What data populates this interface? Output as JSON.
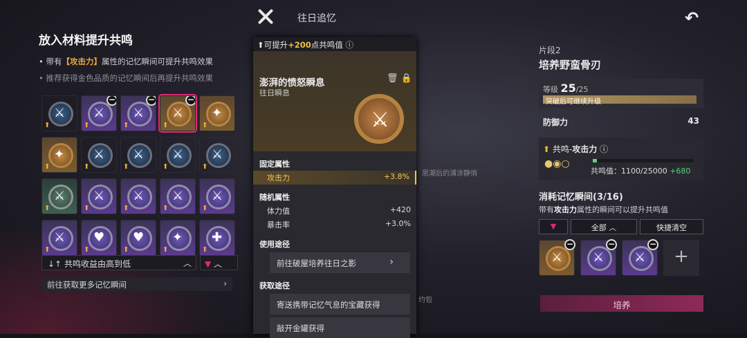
{
  "header": {
    "title": "往日追忆"
  },
  "left": {
    "title": "放入材料提升共鸣",
    "note1_pre": "带有",
    "note1_key": "【攻击力】",
    "note1_post": "属性的记忆瞬间可提升共鸣效果",
    "note2": "推荐获得金色品质的记忆瞬间后再提升共鸣效果",
    "sort_label": "共鸣收益由高到低",
    "more_label": "前往获取更多记忆瞬间"
  },
  "grid": [
    {
      "color": "blue",
      "glyph": "⚔",
      "minus": false,
      "selected": false
    },
    {
      "color": "purple",
      "glyph": "⚔",
      "minus": true,
      "selected": false
    },
    {
      "color": "purple",
      "glyph": "⚔",
      "minus": true,
      "selected": false
    },
    {
      "color": "gold",
      "glyph": "⚔",
      "minus": true,
      "selected": true
    },
    {
      "color": "gold",
      "glyph": "✦",
      "minus": false,
      "selected": false
    },
    {
      "color": "gold",
      "glyph": "✦",
      "minus": false,
      "selected": false
    },
    {
      "color": "blue",
      "glyph": "⚔",
      "minus": false,
      "selected": false
    },
    {
      "color": "blue",
      "glyph": "⚔",
      "minus": false,
      "selected": false
    },
    {
      "color": "blue",
      "glyph": "⚔",
      "minus": false,
      "selected": false
    },
    {
      "color": "blue",
      "glyph": "⚔",
      "minus": false,
      "selected": false
    },
    {
      "color": "green",
      "glyph": "⚔",
      "minus": false,
      "selected": false
    },
    {
      "color": "purple",
      "glyph": "⚔",
      "minus": false,
      "selected": false
    },
    {
      "color": "purple",
      "glyph": "⚔",
      "minus": false,
      "selected": false
    },
    {
      "color": "purple",
      "glyph": "⚔",
      "minus": false,
      "selected": false
    },
    {
      "color": "purple",
      "glyph": "⚔",
      "minus": false,
      "selected": false
    },
    {
      "color": "purple",
      "glyph": "⚔",
      "minus": false,
      "selected": false
    },
    {
      "color": "purple",
      "glyph": "♥",
      "minus": false,
      "selected": false
    },
    {
      "color": "purple",
      "glyph": "♥",
      "minus": false,
      "selected": false
    },
    {
      "color": "purple",
      "glyph": "✦",
      "minus": false,
      "selected": false
    },
    {
      "color": "purple",
      "glyph": "✚",
      "minus": false,
      "selected": false
    }
  ],
  "tooltip": {
    "caption_pre": "可提升",
    "caption_value": "+200",
    "caption_post": "点共鸣值",
    "name": "澎湃的愤怒瞬息",
    "subtitle": "往日瞬息",
    "fixed_title": "固定属性",
    "fixed_stat": "攻击力",
    "fixed_value": "+3.8%",
    "random_title": "随机属性",
    "random": [
      {
        "name": "体力值",
        "value": "+420"
      },
      {
        "name": "暴击率",
        "value": "+3.0%"
      }
    ],
    "use_title": "使用途径",
    "use_btn": "前往破屋培养往日之影",
    "get_title": "获取途径",
    "get1": "寄送携带记忆气息的宝藏获得",
    "get2": "敲开金罐获得"
  },
  "right": {
    "fragment": "片段2",
    "name": "培养野蛮骨刃",
    "level_label": "等级",
    "level": "25",
    "level_max": "/25",
    "level_note": "突破后可继续升级",
    "def_label": "防御力",
    "def_value": "43",
    "reso_pre": "共鸣-",
    "reso_key": "攻击力",
    "reso_value_label": "共鸣值：",
    "reso_value": "1100/25000",
    "reso_gain": "+680",
    "reso_fill": 0.044
  },
  "consume": {
    "title": "消耗记忆瞬间(3/16)",
    "hint_pre": "带有",
    "hint_key": "攻击力",
    "hint_post": "属性的瞬间可以提升共鸣值",
    "filter_all": "全部",
    "clear": "快捷清空",
    "cultivate": "培养"
  },
  "faded": {
    "text1": "思潮后的浦涂静悄",
    "text2": "约包"
  }
}
